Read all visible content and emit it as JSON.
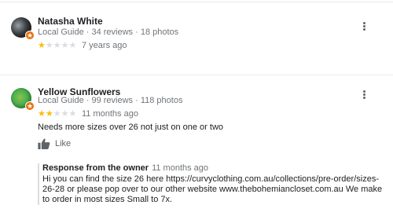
{
  "reviews": [
    {
      "name": "Natasha White",
      "meta": "Local Guide · 34 reviews · 18 photos",
      "rating": 1,
      "when": "7 years ago"
    },
    {
      "name": "Yellow Sunflowers",
      "meta": "Local Guide · 99 reviews · 118 photos",
      "rating": 2,
      "when": "11 months ago",
      "text": "Needs more sizes over 26 not just on one or two",
      "like_label": "Like",
      "owner_response": {
        "heading": "Response from the owner",
        "when": "11 months ago",
        "body": "Hi you can find the size 26 here https://curvyclothing.com.au/collections/pre-order/sizes-26-28 or please pop over to our other website www.thebohemiancloset.com.au We make to order in most sizes Small to 7x."
      }
    }
  ],
  "star_glyph": "★",
  "colors": {
    "star_on": "#fbbc04",
    "star_off": "#dadce0",
    "badge": "#e8710a"
  }
}
